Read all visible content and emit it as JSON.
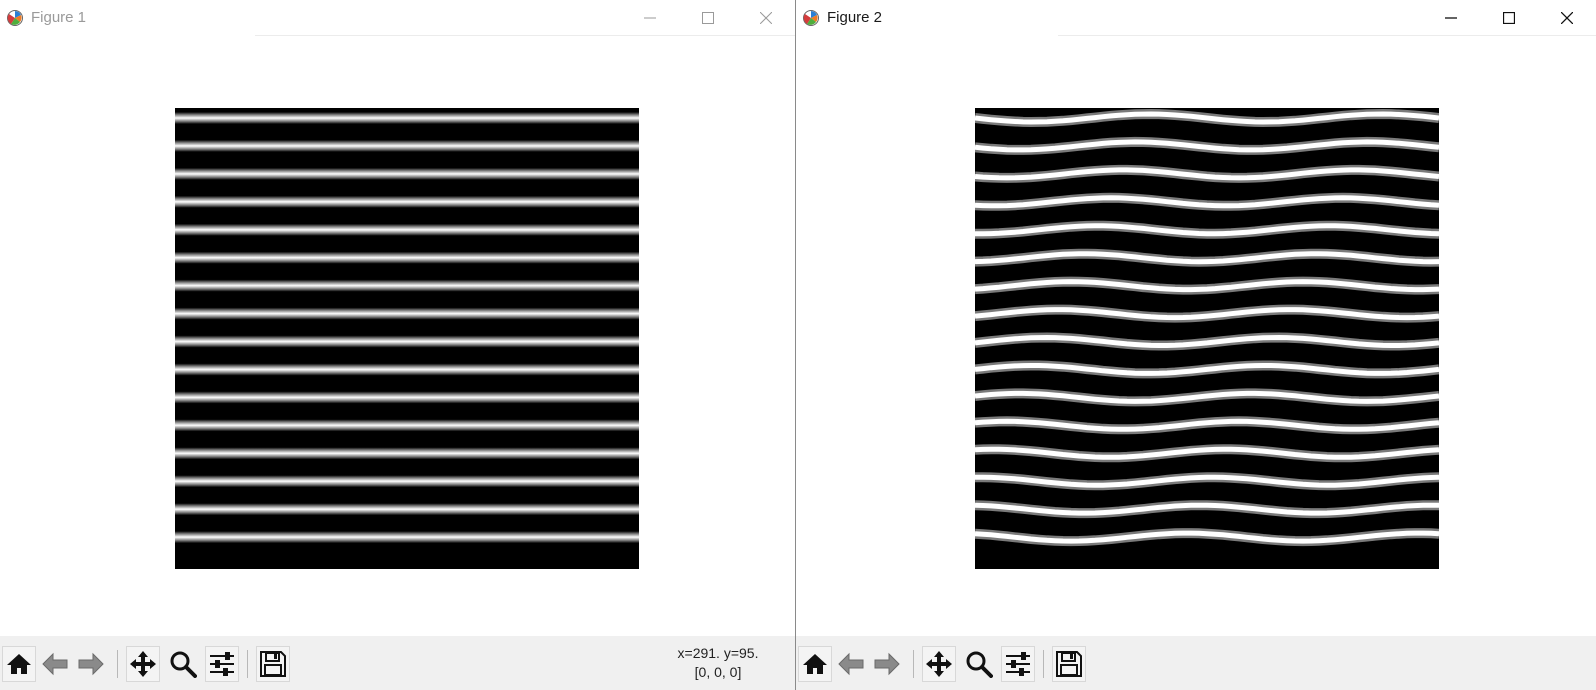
{
  "figures": [
    {
      "title": "Figure 1",
      "active": false,
      "stripes": "straight",
      "status_coords": "x=291. y=95.",
      "status_pixel": "[0, 0, 0]"
    },
    {
      "title": "Figure 2",
      "active": true,
      "stripes": "wavy",
      "status_coords": "",
      "status_pixel": ""
    }
  ],
  "toolbar": {
    "buttons": [
      "home-icon",
      "back-arrow-icon",
      "forward-arrow-icon",
      "pan-icon",
      "zoom-icon",
      "configure-subplots-icon",
      "save-icon"
    ]
  },
  "image": {
    "stripe_count": 16,
    "colors": {
      "stripe": "#ffffff",
      "background": "#000000"
    }
  }
}
